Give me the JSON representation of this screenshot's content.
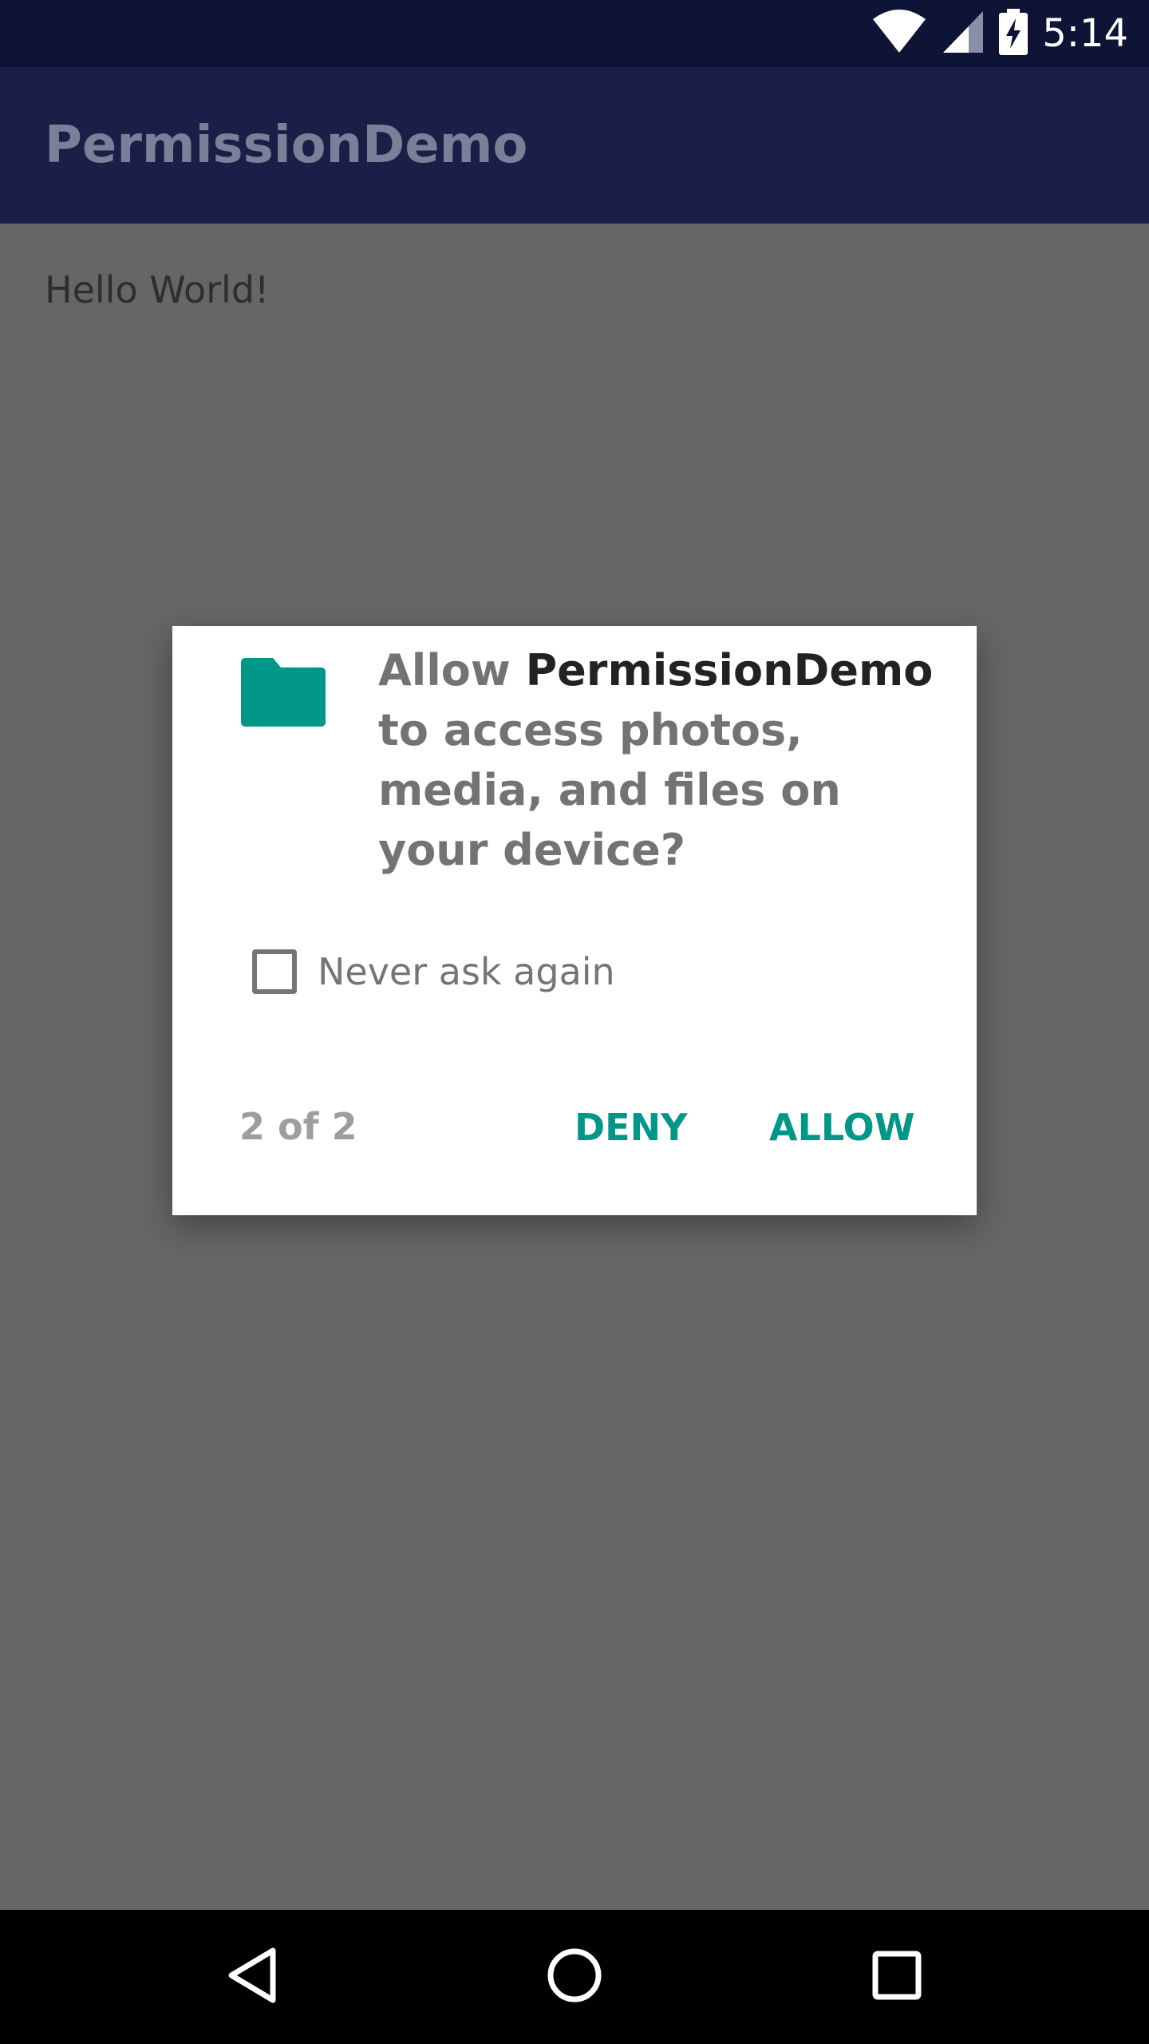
{
  "status_bar": {
    "time": "5:14",
    "icons": [
      "wifi-icon",
      "cellular-signal-icon",
      "battery-charging-icon"
    ]
  },
  "app_bar": {
    "title": "PermissionDemo"
  },
  "content": {
    "text": "Hello World!"
  },
  "dialog": {
    "icon": "folder-icon",
    "message_prefix": "Allow ",
    "app_name": "PermissionDemo",
    "message_suffix": " to access photos, media, and files on your device?",
    "checkbox_label": "Never ask again",
    "checkbox_checked": false,
    "counter": "2 of 2",
    "deny_label": "DENY",
    "allow_label": "ALLOW"
  },
  "nav_bar": {
    "buttons": [
      "back-icon",
      "home-icon",
      "recents-icon"
    ]
  },
  "colors": {
    "status_bar": "#0d1435",
    "app_bar": "#1a1f48",
    "scrim_background": "#666666",
    "accent": "#009688"
  }
}
